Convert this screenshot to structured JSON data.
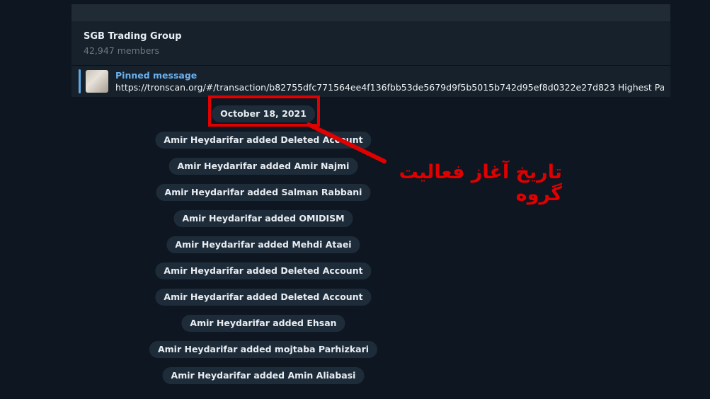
{
  "header": {
    "title": "SGB Trading Group",
    "members": "42,947 members"
  },
  "pinned": {
    "label": "Pinned message",
    "text": "https://tronscan.org/#/transaction/b82755dfc771564ee4f136fbb53de5679d9f5b5015b742d95ef8d0322e27d823  Highest Payout",
    "emoji": "🔥"
  },
  "chat": {
    "date": "October 18, 2021",
    "service_messages": [
      "Amir Heydarifar added Deleted Account",
      "Amir Heydarifar added Amir Najmi",
      "Amir Heydarifar added Salman Rabbani",
      "Amir Heydarifar added OMIDISM",
      "Amir Heydarifar added Mehdi Ataei",
      "Amir Heydarifar added Deleted Account",
      "Amir Heydarifar added Deleted Account",
      "Amir Heydarifar added Ehsan",
      "Amir Heydarifar added mojtaba Parhizkari",
      "Amir Heydarifar added Amin Aliabasi"
    ]
  },
  "annotation": {
    "text": "تاریخ آغاز فعالیت گروه",
    "color": "#e00000"
  }
}
